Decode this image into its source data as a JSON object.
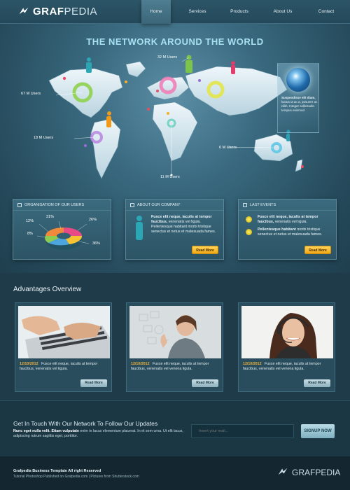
{
  "brand": {
    "name_bold": "GRAF",
    "name_light": "PEDIA"
  },
  "nav": {
    "items": [
      "Home",
      "Services",
      "Products",
      "About Us",
      "Contact"
    ]
  },
  "hero": {
    "title": "THE NETWORK AROUND THE WORLD",
    "callouts": [
      "32 M Users",
      "67 M Users",
      "18 M Users",
      "11 M Users",
      "6 M Users"
    ],
    "globe_panel": {
      "bold": "Suspendisse elit diam,",
      "text": "luctus ut ac a, posuere ac nibh. Integer sollicitudin tempus euismod"
    }
  },
  "boxes": [
    {
      "title": "ORGANISATION OF OUR USERS",
      "labels": [
        "31%",
        "12%",
        "26%",
        "8%",
        "36%"
      ]
    },
    {
      "title": "ABOUT OUR COMPANY",
      "bold": "Fusce elit neque, iaculis at tempor faucibus,",
      "text": "venenatis vel ligula.",
      "text2": "Pellentesque habitant morbi tristique senectus et netus et malesuada fames.",
      "button": "Read More"
    },
    {
      "title": "LAST EVENTS",
      "events": [
        {
          "bold": "Fusce elit neque, iaculis at tempor faucibus,",
          "text": "venenatis vel ligula."
        },
        {
          "bold": "Pellentesque habitant",
          "text": "morbi tristique senectus et netus et malesuada fames."
        }
      ],
      "button": "Read More"
    }
  ],
  "advantages": {
    "title": "Advantages Overview",
    "cards": [
      {
        "date": "12/10/2012",
        "text": "Fusce elit neque, iaculis at tempor faucibus, venenatis vel ligula.",
        "button": "Read More"
      },
      {
        "date": "12/10/2012",
        "text": "Fusce elit neque, iaculis at tempor faucibus, venenatis vel venena ligula.",
        "button": "Read More"
      },
      {
        "date": "12/10/2012",
        "text": "Fusce elit neque, iaculis at tempor faucibus, venenatis vel venena ligula.",
        "button": "Read More"
      }
    ]
  },
  "newsletter": {
    "title": "Get In Touch With Our Network To Follow Our Updates",
    "bold": "Nunc eget nulla velit. Etiam vulputate",
    "text": "enim in lacus elementum placerat. In et sem urna. Ut elit lacus, adipiscing rutrum sagittis eget, porttitor.",
    "placeholder": "Insert your mail...",
    "button": "SIGNUP NOW"
  },
  "footer": {
    "line1": "Grafpedia Business Template All right Reserved",
    "line2": "Tutorial Photoshop Published on Grafpedia.com | Pictures from Shutterstock.com"
  },
  "colors": {
    "accent": "#f2a915",
    "date": "#f0b23a",
    "heading": "#a8e0f0"
  }
}
